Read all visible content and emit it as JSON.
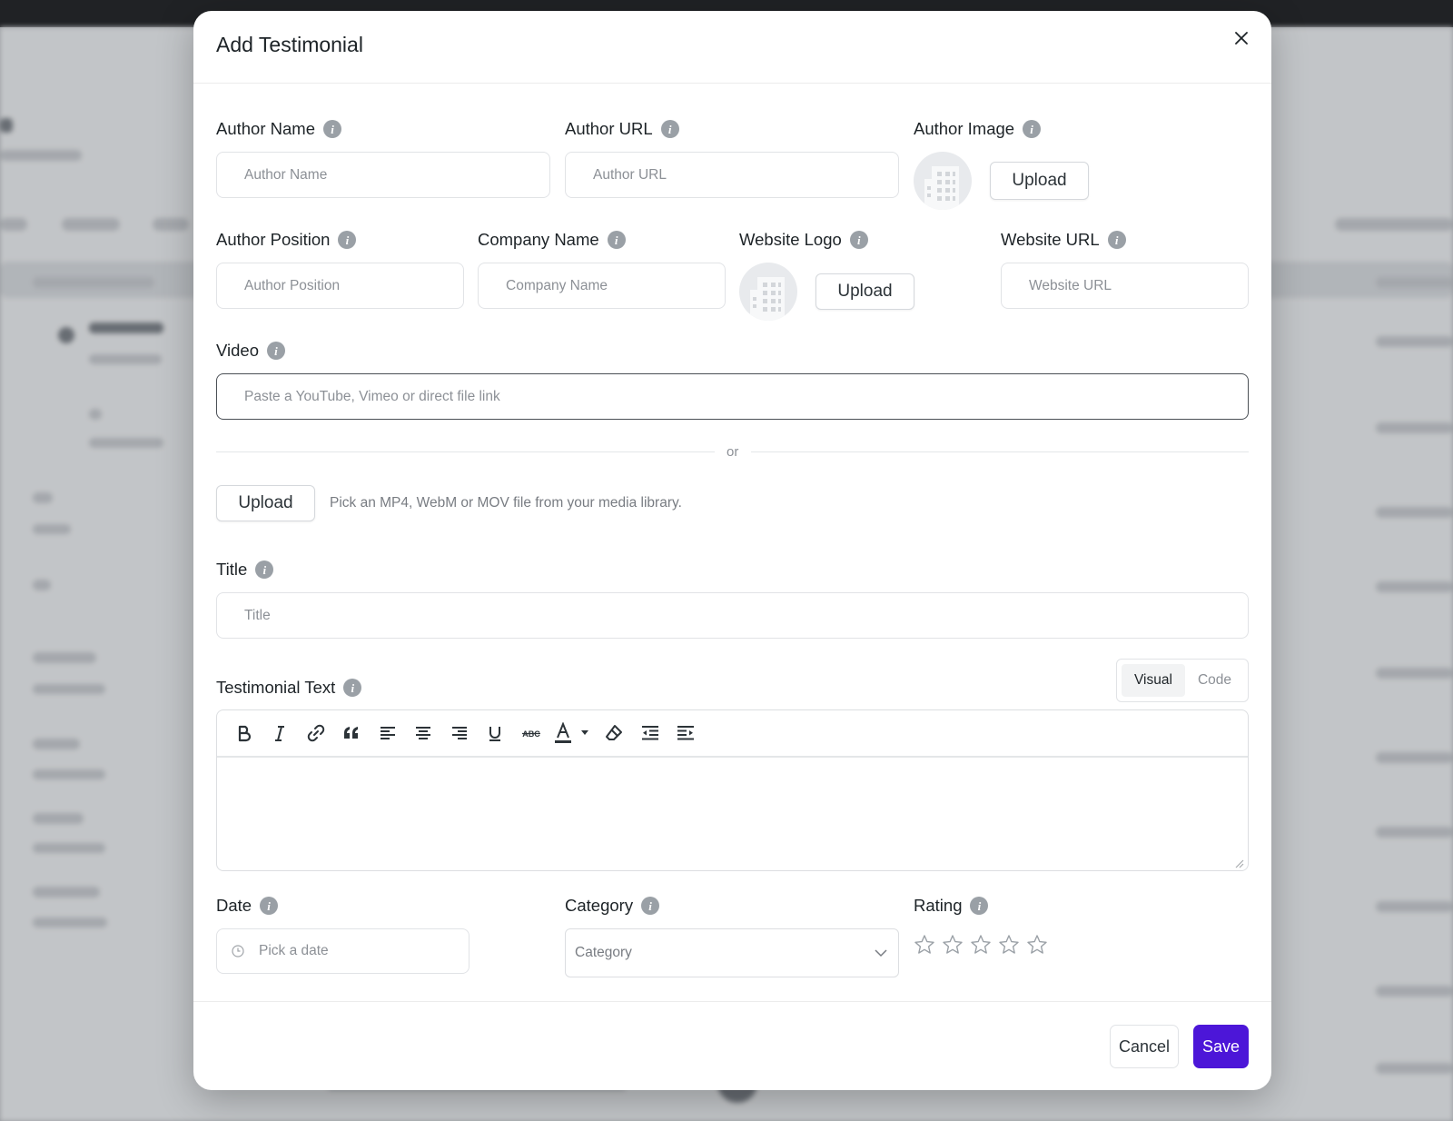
{
  "modal": {
    "title": "Add Testimonial"
  },
  "fields": {
    "author_name": {
      "label": "Author Name",
      "placeholder": "Author Name"
    },
    "author_url": {
      "label": "Author URL",
      "placeholder": "Author URL"
    },
    "author_image": {
      "label": "Author Image",
      "upload_label": "Upload"
    },
    "author_position": {
      "label": "Author Position",
      "placeholder": "Author Position"
    },
    "company_name": {
      "label": "Company Name",
      "placeholder": "Company Name"
    },
    "website_logo": {
      "label": "Website Logo",
      "upload_label": "Upload"
    },
    "website_url": {
      "label": "Website URL",
      "placeholder": "Website URL"
    },
    "video": {
      "label": "Video",
      "placeholder": "Paste a YouTube, Vimeo or direct file link",
      "or_text": "or",
      "upload_label": "Upload",
      "upload_hint": "Pick an MP4, WebM or MOV file from your media library."
    },
    "title": {
      "label": "Title",
      "placeholder": "Title"
    },
    "testimonial_text": {
      "label": "Testimonial Text",
      "tabs": [
        "Visual",
        "Code"
      ],
      "active_tab": "Visual",
      "toolbar": [
        "bold-icon",
        "italic-icon",
        "link-icon",
        "blockquote-icon",
        "align-left-icon",
        "align-center-icon",
        "align-right-icon",
        "underline-icon",
        "strikethrough-icon",
        "text-color-icon",
        "clear-formatting-icon",
        "outdent-icon",
        "indent-icon"
      ]
    },
    "date": {
      "label": "Date",
      "placeholder": "Pick a date"
    },
    "category": {
      "label": "Category",
      "placeholder": "Category"
    },
    "rating": {
      "label": "Rating",
      "value": 0,
      "max": 5
    }
  },
  "footer": {
    "cancel_label": "Cancel",
    "save_label": "Save"
  },
  "colors": {
    "primary": "#4c16d8",
    "info_icon": "#9aa0a6",
    "border": "#e1e3e6"
  }
}
